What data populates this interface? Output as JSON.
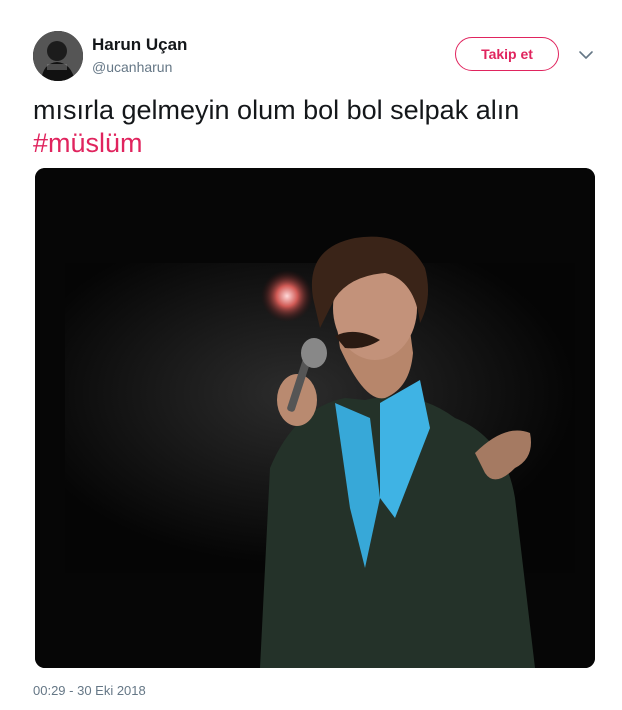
{
  "user": {
    "display_name": "Harun Uçan",
    "handle": "@ucanharun"
  },
  "follow_button": {
    "label": "Takip et"
  },
  "tweet": {
    "text": "mısırla gelmeyin olum bol bol selpak alın",
    "hashtag": "#müslüm",
    "timestamp": "00:29 - 30 Eki 2018"
  },
  "icons": {
    "more": "chevron-down-icon"
  },
  "colors": {
    "accent": "#e0245e",
    "text_primary": "#14171a",
    "text_secondary": "#657786"
  }
}
